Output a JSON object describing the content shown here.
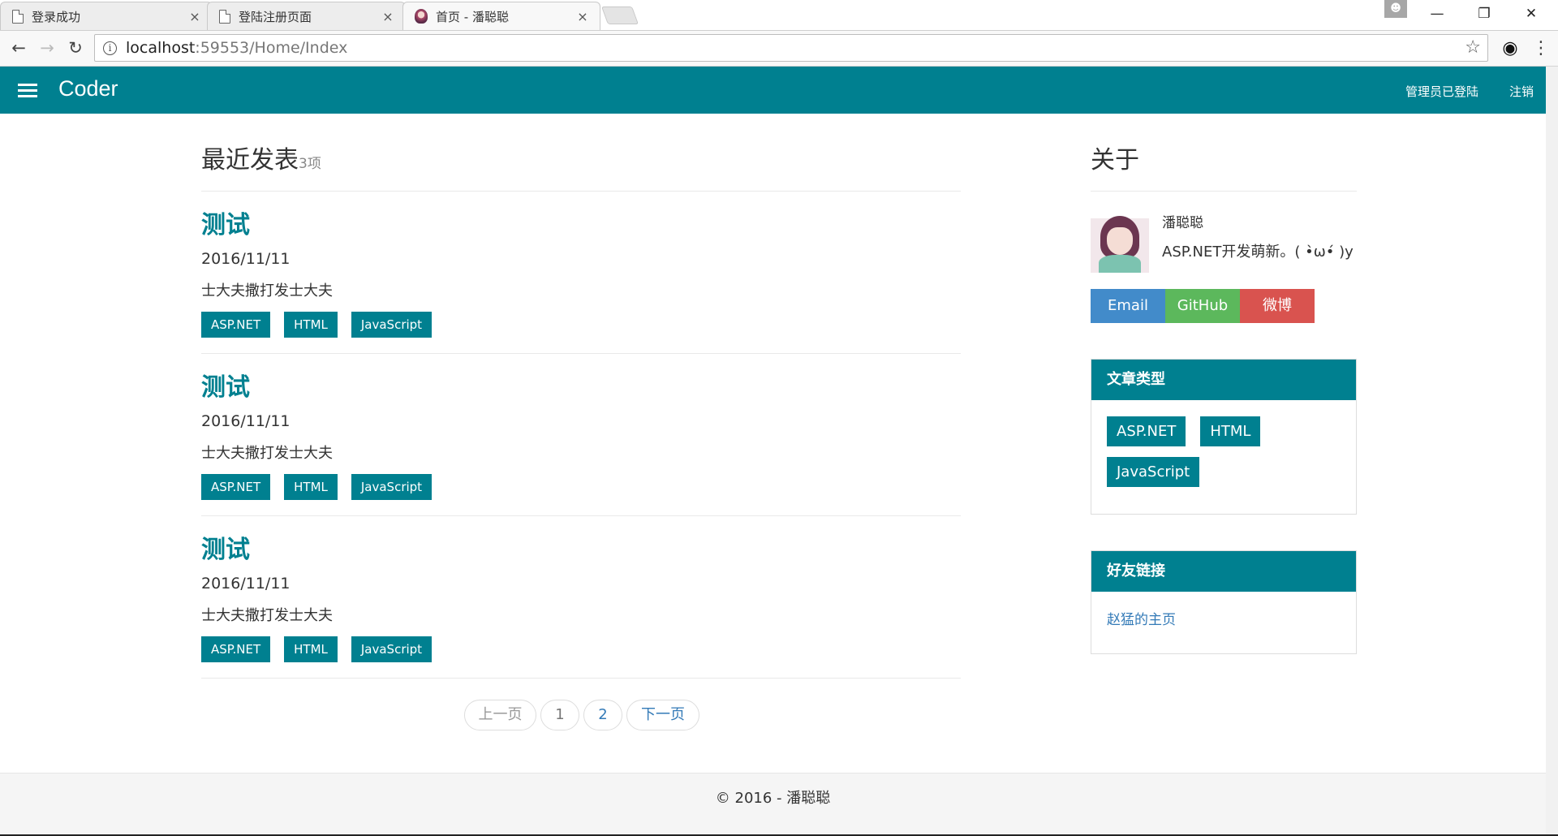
{
  "browser": {
    "tabs": [
      {
        "title": "登录成功",
        "close": "×"
      },
      {
        "title": "登陆注册页面",
        "close": "×"
      },
      {
        "title": "首页 - 潘聪聪",
        "close": "×"
      }
    ],
    "url_host": "localhost",
    "url_path": ":59553/Home/Index",
    "back_icon": "arrow-left-icon",
    "forward_icon": "arrow-right-icon",
    "reload_icon": "reload-icon",
    "star_icon": "star-icon",
    "window": {
      "minimize": "—",
      "restore": "❐",
      "close": "✕"
    }
  },
  "header": {
    "brand": "Coder",
    "admin_status": "管理员已登陆",
    "logout": "注销",
    "color": "#008090"
  },
  "main": {
    "title": "最近发表",
    "count": "3项",
    "posts": [
      {
        "title": "测试",
        "date": "2016/11/11",
        "excerpt": "士大夫撒打发士大夫",
        "tags": [
          "ASP.NET",
          "HTML",
          "JavaScript"
        ]
      },
      {
        "title": "测试",
        "date": "2016/11/11",
        "excerpt": "士大夫撒打发士大夫",
        "tags": [
          "ASP.NET",
          "HTML",
          "JavaScript"
        ]
      },
      {
        "title": "测试",
        "date": "2016/11/11",
        "excerpt": "士大夫撒打发士大夫",
        "tags": [
          "ASP.NET",
          "HTML",
          "JavaScript"
        ]
      }
    ],
    "pager": {
      "prev": "上一页",
      "page1": "1",
      "page2": "2",
      "next": "下一页"
    }
  },
  "sidebar": {
    "about_title": "关于",
    "name": "潘聪聪",
    "bio": "ASP.NET开发萌新。( •̀ω•́ )y",
    "social": [
      {
        "label": "Email",
        "color": "#428bca"
      },
      {
        "label": "GitHub",
        "color": "#5cb85c"
      },
      {
        "label": "微博",
        "color": "#d9534f"
      }
    ],
    "categories_title": "文章类型",
    "categories": [
      "ASP.NET",
      "HTML",
      "JavaScript"
    ],
    "friends_title": "好友链接",
    "friends": [
      "赵猛的主页"
    ]
  },
  "footer": {
    "text": "© 2016 - 潘聪聪"
  }
}
